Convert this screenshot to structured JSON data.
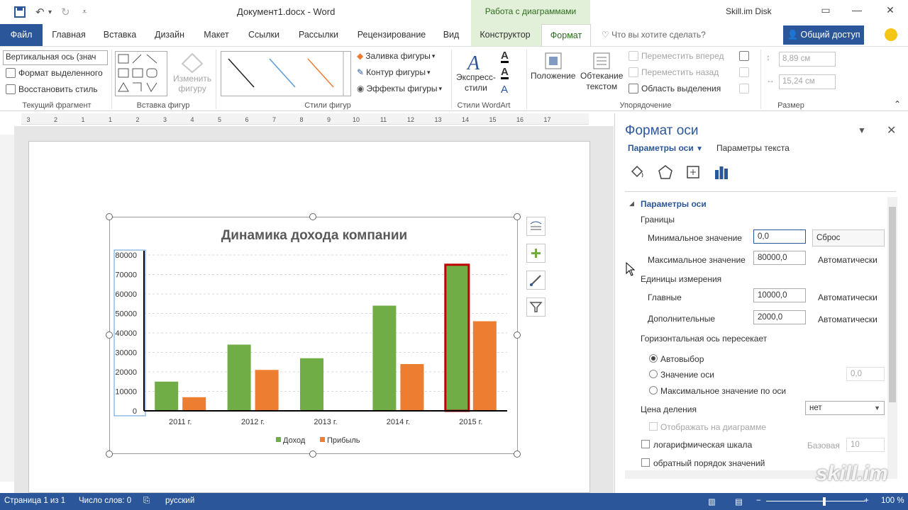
{
  "window": {
    "doc_title": "Документ1.docx - Word",
    "context_title": "Работа с диаграммами",
    "account": "Skill.im Disk"
  },
  "tabs": [
    "Файл",
    "Главная",
    "Вставка",
    "Дизайн",
    "Макет",
    "Ссылки",
    "Рассылки",
    "Рецензирование",
    "Вид",
    "Конструктор",
    "Формат"
  ],
  "tellme_placeholder": "Что вы хотите сделать?",
  "share_label": "Общий доступ",
  "ribbon": {
    "selection_combo": "Вертикальная ось (знач",
    "format_selection": "Формат выделенного",
    "reset_style": "Восстановить стиль",
    "group_current": "Текущий фрагмент",
    "change_shape": "Изменить",
    "change_shape2": "фигуру",
    "group_insert_shapes": "Вставка фигур",
    "group_shape_styles": "Стили фигур",
    "fill": "Заливка фигуры",
    "outline": "Контур фигуры",
    "effects": "Эффекты фигуры",
    "express_styles": "Экспресс-",
    "express_styles2": "стили",
    "group_wordart": "Стили WordArt",
    "position": "Положение",
    "wrap": "Обтекание",
    "wrap2": "текстом",
    "bring_forward": "Переместить вперед",
    "send_backward": "Переместить назад",
    "selection_pane": "Область выделения",
    "group_arrange": "Упорядочение",
    "height": "8,89 см",
    "width": "15,24 см",
    "group_size": "Размер"
  },
  "ruler_numbers": [
    "3",
    "2",
    "1",
    "1",
    "2",
    "3",
    "4",
    "5",
    "6",
    "7",
    "8",
    "9",
    "10",
    "11",
    "12",
    "13",
    "14",
    "15",
    "16",
    "17"
  ],
  "chart_data": {
    "type": "bar",
    "title": "Динамика дохода компании",
    "categories": [
      "2011 г.",
      "2012 г.",
      "2013 г.",
      "2014 г.",
      "2015 г."
    ],
    "series": [
      {
        "name": "Доход",
        "values": [
          15000,
          34000,
          27000,
          54000,
          75000
        ],
        "color": "#70ad47"
      },
      {
        "name": "Прибыль",
        "values": [
          7000,
          21000,
          0,
          24000,
          46000
        ],
        "color": "#ed7d31"
      }
    ],
    "ylim": [
      0,
      80000
    ],
    "yticks": [
      0,
      10000,
      20000,
      30000,
      40000,
      50000,
      60000,
      70000,
      80000
    ],
    "ytick_labels": [
      "0",
      "10000",
      "20000",
      "30000",
      "40000",
      "50000",
      "60000",
      "70000",
      "80000"
    ],
    "legend": "bottom",
    "grid": true,
    "highlighted_bar": {
      "series": 0,
      "category": 4,
      "outline": "#c00000"
    }
  },
  "pane": {
    "title": "Формат оси",
    "tab_axis": "Параметры оси",
    "tab_text": "Параметры текста",
    "section": "Параметры оси",
    "bounds": "Границы",
    "min_label": "Минимальное значение",
    "min_value": "0,0",
    "min_action": "Сброс",
    "max_label": "Максимальное значение",
    "max_value": "80000,0",
    "max_action": "Автоматически",
    "units": "Единицы измерения",
    "major_label": "Главные",
    "major_value": "10000,0",
    "major_action": "Автоматически",
    "minor_label": "Дополнительные",
    "minor_value": "2000,0",
    "minor_action": "Автоматически",
    "cross_label": "Горизонтальная ось пересекает",
    "radio_auto": "Автовыбор",
    "radio_value": "Значение оси",
    "radio_value_field": "0,0",
    "radio_max": "Максимальное значение по оси",
    "display_units": "Цена деления",
    "display_units_value": "нет",
    "show_on_chart": "Отображать на диаграмме",
    "log_scale": "логарифмическая шкала",
    "log_base_label": "Базовая",
    "log_base_value": "10",
    "reverse": "обратный порядок значений"
  },
  "status": {
    "page": "Страница 1 из 1",
    "words": "Число слов: 0",
    "lang": "русский",
    "zoom": "100 %"
  },
  "watermark": "skill.im"
}
